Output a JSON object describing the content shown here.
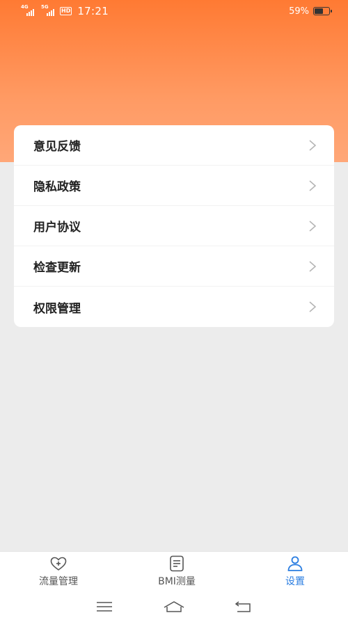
{
  "status_bar": {
    "net1": "4G",
    "net2": "5G",
    "hd": "HD",
    "time": "17:21",
    "battery_percent": "59%",
    "battery_level": 0.59
  },
  "menu": {
    "items": [
      {
        "label": "意见反馈"
      },
      {
        "label": "隐私政策"
      },
      {
        "label": "用户协议"
      },
      {
        "label": "检查更新"
      },
      {
        "label": "权限管理"
      }
    ]
  },
  "tab_bar": {
    "tabs": [
      {
        "label": "流量管理",
        "icon": "heart-plus-icon",
        "active": false
      },
      {
        "label": "BMI测量",
        "icon": "document-icon",
        "active": false
      },
      {
        "label": "设置",
        "icon": "user-icon",
        "active": true
      }
    ]
  },
  "nav_bar": {
    "buttons": [
      "menu-icon",
      "home-icon",
      "back-icon"
    ]
  },
  "colors": {
    "header_gradient_top": "#ff7a33",
    "header_gradient_bottom": "#ffa778",
    "active_tab": "#2a7de1",
    "background": "#ececec"
  }
}
